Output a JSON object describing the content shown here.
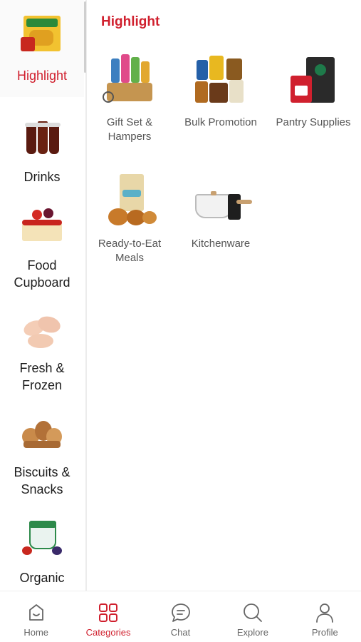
{
  "sidebar": {
    "items": [
      {
        "label": "Highlight",
        "icon": "pasta-pack-icon",
        "active": true
      },
      {
        "label": "Drinks",
        "icon": "soda-glasses-icon",
        "active": false
      },
      {
        "label": "Food Cupboard",
        "icon": "cake-icon",
        "active": false
      },
      {
        "label": "Fresh & Frozen",
        "icon": "chicken-drumsticks-icon",
        "active": false
      },
      {
        "label": "Biscuits & Snacks",
        "icon": "bread-basket-icon",
        "active": false
      },
      {
        "label": "Organic",
        "icon": "yogurt-tub-icon",
        "active": false
      }
    ]
  },
  "main": {
    "section_title": "Highlight",
    "tiles": [
      {
        "label": "Gift Set & Hampers",
        "icon": "hamper-basket-icon"
      },
      {
        "label": "Bulk Promotion",
        "icon": "grocery-bundle-icon"
      },
      {
        "label": "Pantry Supplies",
        "icon": "coffee-pack-icon"
      },
      {
        "label": "Ready-to-Eat Meals",
        "icon": "bread-pack-icon"
      },
      {
        "label": "Kitchenware",
        "icon": "saucepan-icon"
      }
    ]
  },
  "bottom_nav": {
    "items": [
      {
        "label": "Home",
        "icon": "home-icon",
        "active": false
      },
      {
        "label": "Categories",
        "icon": "categories-grid-icon",
        "active": true
      },
      {
        "label": "Chat",
        "icon": "chat-bubble-icon",
        "active": false
      },
      {
        "label": "Explore",
        "icon": "search-icon",
        "active": false
      },
      {
        "label": "Profile",
        "icon": "person-icon",
        "active": false
      }
    ]
  },
  "colors": {
    "accent": "#d0202e",
    "inactive": "#666666",
    "label": "#555555"
  }
}
